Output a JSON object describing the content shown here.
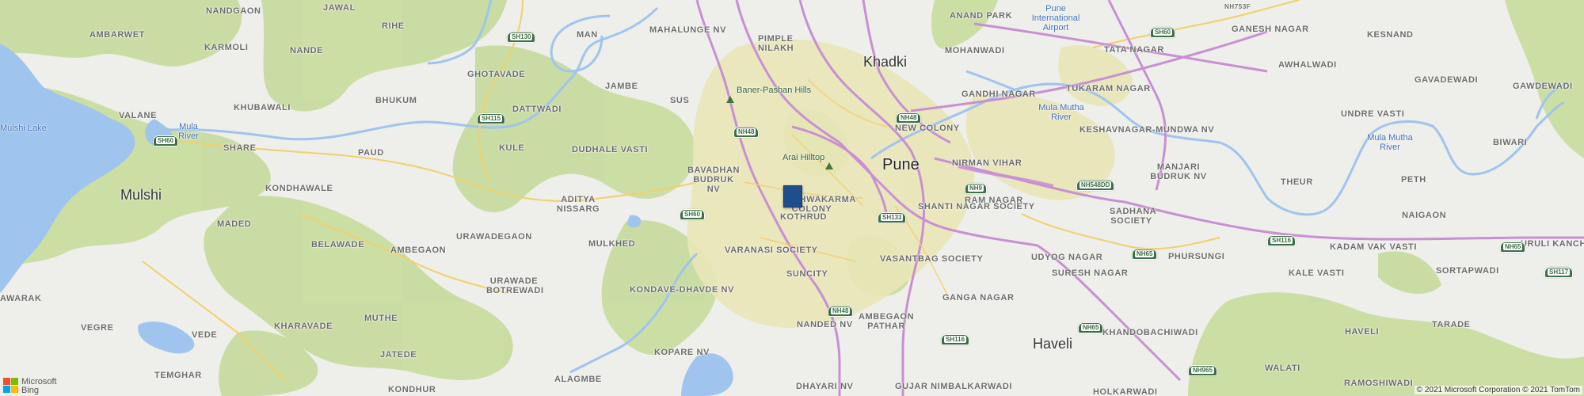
{
  "map": {
    "colors": {
      "land": "#eeeeea",
      "green": "#c5d99a",
      "water": "#9fc4ee",
      "urban": "#e8e4b5",
      "highway": "#c98fd3",
      "road": "#f3cf6b",
      "pin": "#1f4e8c"
    },
    "labels": {
      "nandgaon": "NANDGAON",
      "jawal": "JAWAL",
      "rihe": "RIHE",
      "mahalunge": "MAHALUNGE NV",
      "pimple": "PIMPLE",
      "nilakh": "NILAKH",
      "anand_park": "ANAND PARK",
      "pune_airport": "Pune International Airport",
      "nh753f": "NH753F",
      "ambarwet": "AMBARWET",
      "man": "MAN",
      "sh130": "SH130",
      "mohanwadi": "MOHANWADI",
      "tata_nagar": "TATA NAGAR",
      "sh60a": "SH60",
      "ganesh_nagar": "GANESH NAGAR",
      "kesnand": "KESNAND",
      "karmoli": "KARMOLI",
      "nande": "NANDE",
      "khadki": "Khadki",
      "awhalwadi": "AWHALWADI",
      "gavadewadi": "GAVADEWADI",
      "ghotavade": "GHOTAVADE",
      "jambe": "JAMBE",
      "gandhi_nagar": "GANDHI NAGAR",
      "gawdewadi": "GAWDEWADI",
      "tukaram": "TUKARAM NAGAR",
      "sus": "SUS",
      "baner": "Baner-Pashan Hills",
      "bhukum": "BHUKUM",
      "khubawali": "KHUBAWALI",
      "dattwadi": "DATTWADI",
      "mula_mutha_1": "Mula Mutha River",
      "undre": "UNDRE VASTI",
      "valane": "VALANE",
      "mulshi_lake": "Mulshi Lake",
      "sh115": "SH115",
      "nh48a": "NH48",
      "nh48b": "NH48",
      "new_colony": "NEW COLONY",
      "keshavnagar": "KESHAVNAGAR-MUNDWA NV",
      "mula_river": "Mula River",
      "sh60b": "SH60",
      "share": "SHARE",
      "kule": "KULE",
      "dudhale": "DUDHALE VASTI",
      "arai": "Arai Hilltop",
      "paud": "PAUD",
      "nirman": "NIRMAN VIHAR",
      "mula_mutha_2": "Mula Mutha River",
      "biwari": "BIWARI",
      "pune": "Pune",
      "manjari": "MANJARI BUDRUK NV",
      "mulshi": "Mulshi",
      "kondhawale": "KONDHAWALE",
      "bavadhan": "BAVADHAN BUDRUK NV",
      "nh9": "NH9",
      "theur": "THEUR",
      "peth": "PETH",
      "nh548dd": "NH548DD",
      "aditya": "ADITYA NISSARG",
      "vishwakarma": "VISHWAKARMA COLONY",
      "ram_nagar": "RAM NAGAR",
      "kothrud": "KOTHRUD",
      "shanti": "SHANTI NAGAR SOCIETY",
      "sadhana": "SADHANA SOCIETY",
      "sh60c": "SH60",
      "sh133": "SH133",
      "naigaon": "NAIGAON",
      "maded": "MADED",
      "urawadegaon": "URAWADEGAON",
      "sh116a": "SH116",
      "kadam": "KADAM VAK VASTI",
      "nh65a": "NH65",
      "uruli": "URULI KANCH",
      "mulkhed": "MULKHED",
      "varanasi": "VARANASI SOCIETY",
      "belawade": "BELAWADE",
      "nh65b": "NH65",
      "phursungi": "PHURSUNGI",
      "udyog": "UDYOG NAGAR",
      "suncity": "SUNCITY",
      "vasantbag": "VASANTBAG SOCIETY",
      "suresh": "SURESH NAGAR",
      "kale_vasti": "KALE VASTI",
      "sortapwadi": "SORTAPWADI",
      "sh117": "SH117",
      "ambegaon": "AMBEGAON",
      "urawade": "URAWADE BOTREWADI",
      "kondave": "KONDAVE-DHAVDE NV",
      "ganga": "GANGA NAGAR",
      "awarak": "AWARAK",
      "nh48c": "NH48",
      "ambegaon_pathar": "AMBEGAON PATHAR",
      "muthe": "MUTHE",
      "nh65c": "NH65",
      "khandobachiwadi": "KHANDOBACHIWADI",
      "vegre": "VEGRE",
      "kharavade": "KHARAVADE",
      "nanded": "NANDED NV",
      "vede": "VEDE",
      "sh116b": "SH116",
      "haveli": "Haveli",
      "havell": "HAVELI",
      "tarade": "TARADE",
      "temghar": "TEMGHAR",
      "jatede": "JATEDE",
      "kopare": "KOPARE NV",
      "walati": "WALATI",
      "nh965": "NH965",
      "ramoshiwadi": "RAMOSHIWADI",
      "kondhur": "KONDHUR",
      "alagmbe": "ALAGMBE",
      "dhayari": "DHAYARI NV",
      "gujar": "GUJAR NIMBALKARWADI",
      "holkarwadi": "HOLKARWADI"
    },
    "logo_text_1": "Microsoft",
    "logo_text_2": "Bing",
    "copyright": "© 2021 Microsoft Corporation © 2021 TomTom"
  }
}
